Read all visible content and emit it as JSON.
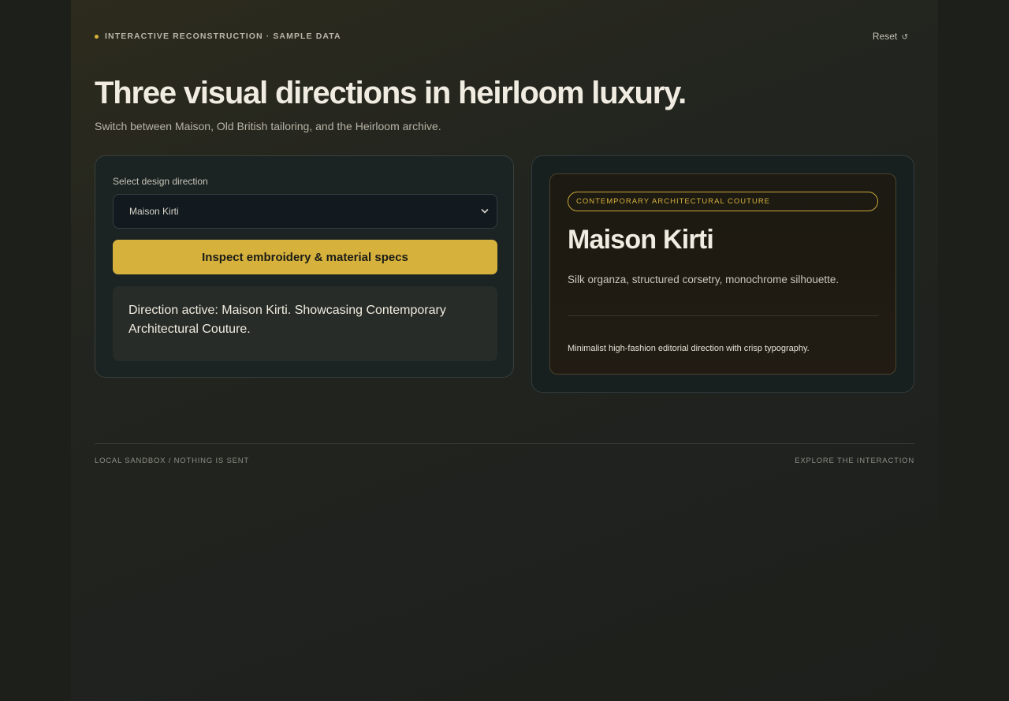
{
  "header": {
    "eyebrow": "INTERACTIVE RECONSTRUCTION · SAMPLE DATA",
    "reset_label": "Reset",
    "reset_icon": "↺",
    "title": "Three visual directions in heirloom luxury.",
    "subtitle": "Switch between Maison, Old British tailoring, and the Heirloom archive."
  },
  "controls": {
    "select_label": "Select design direction",
    "selected_value": "Maison Kirti",
    "button_label": "Inspect embroidery & material specs",
    "status_text": "Direction active: Maison Kirti. Showcasing Contemporary Architectural Couture."
  },
  "preview": {
    "tag": "CONTEMPORARY ARCHITECTURAL COUTURE",
    "name": "Maison Kirti",
    "materials": "Silk organza, structured corsetry, monochrome silhouette.",
    "note": "Minimalist high-fashion editorial direction with crisp typography."
  },
  "footer": {
    "left": "LOCAL SANDBOX / NOTHING IS SENT",
    "right": "EXPLORE THE INTERACTION"
  },
  "colors": {
    "accent": "#d6b13c",
    "background": "#1d1f1b",
    "card": "#1b2423",
    "text": "#f1ece1"
  },
  "icons": {
    "eyebrow_dot": "status-dot-icon",
    "reset": "reset-icon",
    "select": "chevron-down-icon"
  }
}
